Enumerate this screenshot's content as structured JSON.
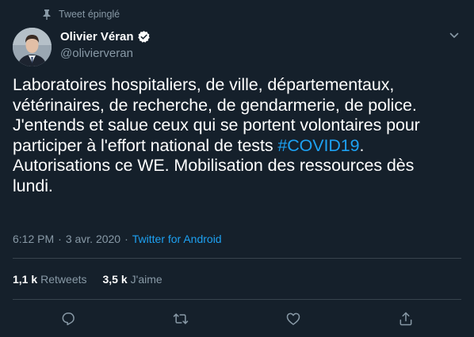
{
  "pinned": {
    "label": "Tweet épinglé"
  },
  "author": {
    "name": "Olivier Véran",
    "handle": "@olivierveran",
    "verified": true
  },
  "tweet": {
    "lines": [
      "Laboratoires hospitaliers, de ville, départementaux,",
      "vétérinaires, de recherche, de gendarmerie, de police.",
      "J'entends et salue ceux qui se portent volontaires pour",
      "participer à l'effort national de tests ",
      "Autorisations ce WE. Mobilisation des ressources dès",
      "lundi."
    ],
    "hashtag": "#COVID19",
    "hashtag_suffix": "."
  },
  "meta": {
    "time": "6:12 PM",
    "separator": "·",
    "date": "3 avr. 2020",
    "source": "Twitter for Android"
  },
  "stats": {
    "retweets_count": "1,1 k",
    "retweets_label": "Retweets",
    "likes_count": "3,5 k",
    "likes_label": "J'aime"
  },
  "icons": {
    "pin": "pin-icon",
    "verified": "verified-badge-icon",
    "more": "chevron-down-icon",
    "reply": "reply-icon",
    "retweet": "retweet-icon",
    "like": "heart-icon",
    "share": "share-icon"
  },
  "colors": {
    "background": "#15202b",
    "text": "#ffffff",
    "secondary": "#8899a6",
    "accent": "#1da1f2",
    "divider": "#38444d"
  }
}
